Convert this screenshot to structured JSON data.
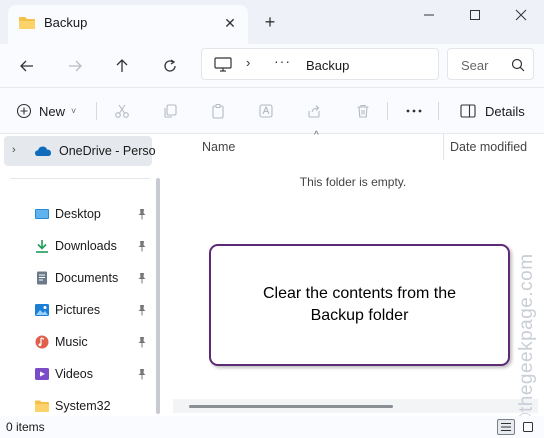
{
  "window": {
    "tab_title": "Backup",
    "new_tab_symbol": "+",
    "close_symbol": "✕",
    "minimize_symbol": "—",
    "maximize_symbol": "☐",
    "window_close_symbol": "✕"
  },
  "address_bar": {
    "separator": "›",
    "ellipsis": "···",
    "path_current": "Backup"
  },
  "search": {
    "placeholder": "Sear"
  },
  "command_bar": {
    "new_label": "New",
    "new_caret": "˅",
    "more_label": "···",
    "details_label": "Details"
  },
  "sidebar": {
    "onedrive_label": "OneDrive - Person",
    "onedrive_chevron": "›",
    "items": [
      {
        "label": "Desktop",
        "icon": "desktop-icon",
        "pinned": true
      },
      {
        "label": "Downloads",
        "icon": "download-icon",
        "pinned": true
      },
      {
        "label": "Documents",
        "icon": "documents-icon",
        "pinned": true
      },
      {
        "label": "Pictures",
        "icon": "pictures-icon",
        "pinned": true
      },
      {
        "label": "Music",
        "icon": "music-icon",
        "pinned": true
      },
      {
        "label": "Videos",
        "icon": "videos-icon",
        "pinned": true
      },
      {
        "label": "System32",
        "icon": "folder-icon",
        "pinned": false
      }
    ]
  },
  "content": {
    "sort_indicator": "^",
    "columns": [
      "Name",
      "Date modified"
    ],
    "empty_message": "This folder is empty."
  },
  "annotation": {
    "text": "Clear the contents from the\nBackup folder"
  },
  "watermark": {
    "text": "©thegeekpage.com"
  },
  "status_bar": {
    "item_count": "0 items"
  },
  "colors": {
    "accent_folder": "#f5c04a",
    "onedrive_blue": "#0f6cbd",
    "callout_border": "#5c2b78",
    "titlebar_bg": "#eef2f8"
  }
}
